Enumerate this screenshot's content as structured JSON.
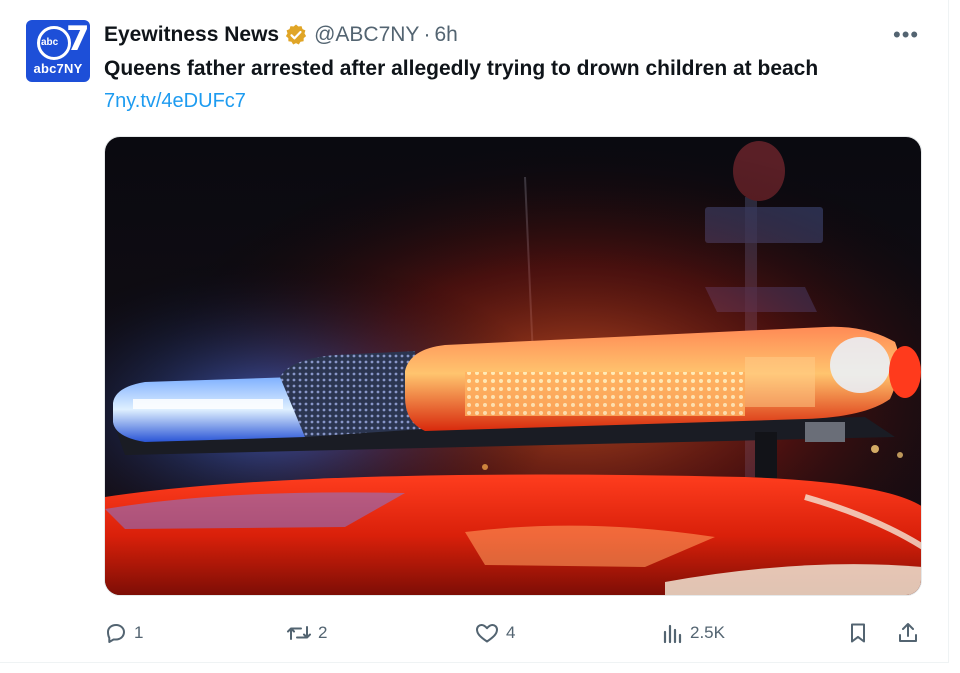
{
  "account": {
    "display_name": "Eyewitness News",
    "handle": "@ABC7NY",
    "separator": "·",
    "time": "6h",
    "avatar_text": "abc7NY",
    "avatar_logo_text": "abc",
    "avatar_logo_number": "7",
    "verified_icon": "verified-badge-icon",
    "badge_color": "#e0a526"
  },
  "tweet": {
    "text": "Queens father arrested after allegedly trying to drown children at beach",
    "link": "7ny.tv/4eDUFc7"
  },
  "actions": {
    "reply": {
      "icon": "reply-icon",
      "count": "1"
    },
    "retweet": {
      "icon": "retweet-icon",
      "count": "2"
    },
    "like": {
      "icon": "heart-icon",
      "count": "4"
    },
    "views": {
      "icon": "analytics-icon",
      "count": "2.5K"
    },
    "bookmark": {
      "icon": "bookmark-icon"
    },
    "share": {
      "icon": "share-icon"
    }
  },
  "colors": {
    "link": "#1d9bf0",
    "muted": "#536471",
    "avatar_bg": "#1d4fd8"
  }
}
